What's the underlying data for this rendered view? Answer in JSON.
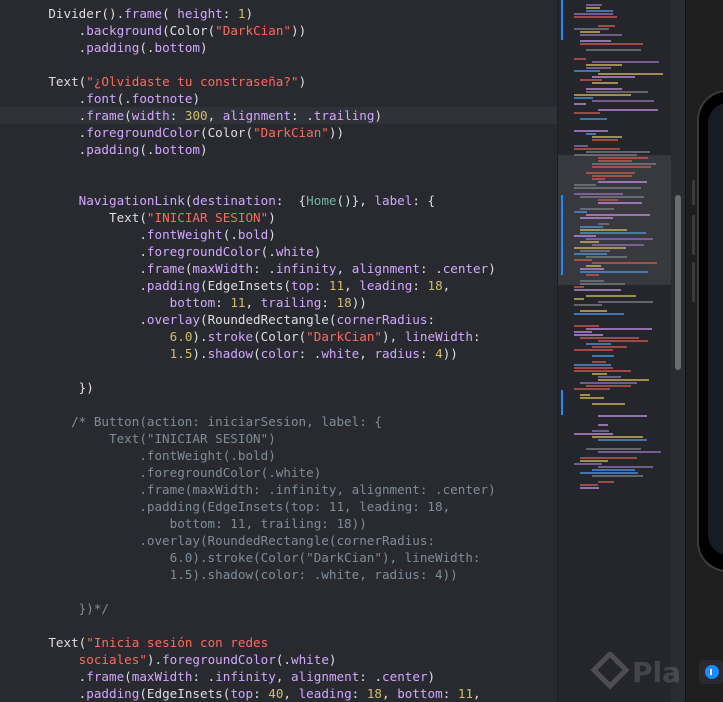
{
  "editor": {
    "lines": [
      [
        {
          "t": "    Divider().",
          "c": "t-plain"
        },
        {
          "t": "frame",
          "c": "t-kw"
        },
        {
          "t": "( ",
          "c": "t-plain"
        },
        {
          "t": "height",
          "c": "t-kw"
        },
        {
          "t": ": ",
          "c": "t-plain"
        },
        {
          "t": "1",
          "c": "t-num"
        },
        {
          "t": ")",
          "c": "t-plain"
        }
      ],
      [
        {
          "t": "        .",
          "c": "t-plain"
        },
        {
          "t": "background",
          "c": "t-kw"
        },
        {
          "t": "(Color(",
          "c": "t-plain"
        },
        {
          "t": "\"DarkCian\"",
          "c": "t-str"
        },
        {
          "t": "))",
          "c": "t-plain"
        }
      ],
      [
        {
          "t": "        .",
          "c": "t-plain"
        },
        {
          "t": "padding",
          "c": "t-kw"
        },
        {
          "t": "(.",
          "c": "t-plain"
        },
        {
          "t": "bottom",
          "c": "t-kw"
        },
        {
          "t": ")",
          "c": "t-plain"
        }
      ],
      [],
      [
        {
          "t": "    Text(",
          "c": "t-plain"
        },
        {
          "t": "\"¿Olvidaste tu constraseña?\"",
          "c": "t-str"
        },
        {
          "t": ")",
          "c": "t-plain"
        }
      ],
      [
        {
          "t": "        .",
          "c": "t-plain"
        },
        {
          "t": "font",
          "c": "t-kw"
        },
        {
          "t": "(.",
          "c": "t-plain"
        },
        {
          "t": "footnote",
          "c": "t-kw"
        },
        {
          "t": ")",
          "c": "t-plain"
        }
      ],
      [
        {
          "t": "        .",
          "c": "t-plain"
        },
        {
          "t": "frame",
          "c": "t-kw"
        },
        {
          "t": "(",
          "c": "t-plain"
        },
        {
          "t": "width",
          "c": "t-kw"
        },
        {
          "t": ": ",
          "c": "t-plain"
        },
        {
          "t": "300",
          "c": "t-num"
        },
        {
          "t": ", ",
          "c": "t-plain"
        },
        {
          "t": "alignment",
          "c": "t-kw"
        },
        {
          "t": ": .",
          "c": "t-plain"
        },
        {
          "t": "trailing",
          "c": "t-kw"
        },
        {
          "t": ")",
          "c": "t-plain"
        }
      ],
      [
        {
          "t": "        .",
          "c": "t-plain"
        },
        {
          "t": "foregroundColor",
          "c": "t-kw"
        },
        {
          "t": "(Color(",
          "c": "t-plain"
        },
        {
          "t": "\"DarkCian\"",
          "c": "t-str"
        },
        {
          "t": "))",
          "c": "t-plain"
        }
      ],
      [
        {
          "t": "        .",
          "c": "t-plain"
        },
        {
          "t": "padding",
          "c": "t-kw"
        },
        {
          "t": "(.",
          "c": "t-plain"
        },
        {
          "t": "bottom",
          "c": "t-kw"
        },
        {
          "t": ")",
          "c": "t-plain"
        }
      ],
      [],
      [],
      [
        {
          "t": "        NavigationLink",
          "c": "t-kw"
        },
        {
          "t": "(",
          "c": "t-plain"
        },
        {
          "t": "destination",
          "c": "t-kw"
        },
        {
          "t": ":  {",
          "c": "t-plain"
        },
        {
          "t": "Home",
          "c": "t-id"
        },
        {
          "t": "()}, ",
          "c": "t-plain"
        },
        {
          "t": "label",
          "c": "t-kw"
        },
        {
          "t": ": {",
          "c": "t-plain"
        }
      ],
      [
        {
          "t": "            Text(",
          "c": "t-plain"
        },
        {
          "t": "\"INICIAR SESION\"",
          "c": "t-str"
        },
        {
          "t": ")",
          "c": "t-plain"
        }
      ],
      [
        {
          "t": "                .",
          "c": "t-plain"
        },
        {
          "t": "fontWeight",
          "c": "t-kw"
        },
        {
          "t": "(.",
          "c": "t-plain"
        },
        {
          "t": "bold",
          "c": "t-kw"
        },
        {
          "t": ")",
          "c": "t-plain"
        }
      ],
      [
        {
          "t": "                .",
          "c": "t-plain"
        },
        {
          "t": "foregroundColor",
          "c": "t-kw"
        },
        {
          "t": "(.",
          "c": "t-plain"
        },
        {
          "t": "white",
          "c": "t-kw"
        },
        {
          "t": ")",
          "c": "t-plain"
        }
      ],
      [
        {
          "t": "                .",
          "c": "t-plain"
        },
        {
          "t": "frame",
          "c": "t-kw"
        },
        {
          "t": "(",
          "c": "t-plain"
        },
        {
          "t": "maxWidth",
          "c": "t-kw"
        },
        {
          "t": ": .",
          "c": "t-plain"
        },
        {
          "t": "infinity",
          "c": "t-kw"
        },
        {
          "t": ", ",
          "c": "t-plain"
        },
        {
          "t": "alignment",
          "c": "t-kw"
        },
        {
          "t": ": .",
          "c": "t-plain"
        },
        {
          "t": "center",
          "c": "t-kw"
        },
        {
          "t": ")",
          "c": "t-plain"
        }
      ],
      [
        {
          "t": "                .",
          "c": "t-plain"
        },
        {
          "t": "padding",
          "c": "t-kw"
        },
        {
          "t": "(EdgeInsets(",
          "c": "t-plain"
        },
        {
          "t": "top",
          "c": "t-kw"
        },
        {
          "t": ": ",
          "c": "t-plain"
        },
        {
          "t": "11",
          "c": "t-num"
        },
        {
          "t": ", ",
          "c": "t-plain"
        },
        {
          "t": "leading",
          "c": "t-kw"
        },
        {
          "t": ": ",
          "c": "t-plain"
        },
        {
          "t": "18",
          "c": "t-num"
        },
        {
          "t": ",",
          "c": "t-plain"
        }
      ],
      [
        {
          "t": "                    ",
          "c": "t-plain"
        },
        {
          "t": "bottom",
          "c": "t-kw"
        },
        {
          "t": ": ",
          "c": "t-plain"
        },
        {
          "t": "11",
          "c": "t-num"
        },
        {
          "t": ", ",
          "c": "t-plain"
        },
        {
          "t": "trailing",
          "c": "t-kw"
        },
        {
          "t": ": ",
          "c": "t-plain"
        },
        {
          "t": "18",
          "c": "t-num"
        },
        {
          "t": "))",
          "c": "t-plain"
        }
      ],
      [
        {
          "t": "                .",
          "c": "t-plain"
        },
        {
          "t": "overlay",
          "c": "t-kw"
        },
        {
          "t": "(RoundedRectangle(",
          "c": "t-plain"
        },
        {
          "t": "cornerRadius",
          "c": "t-kw"
        },
        {
          "t": ":",
          "c": "t-plain"
        }
      ],
      [
        {
          "t": "                    ",
          "c": "t-plain"
        },
        {
          "t": "6.0",
          "c": "t-num"
        },
        {
          "t": ").",
          "c": "t-plain"
        },
        {
          "t": "stroke",
          "c": "t-kw"
        },
        {
          "t": "(Color(",
          "c": "t-plain"
        },
        {
          "t": "\"DarkCian\"",
          "c": "t-str"
        },
        {
          "t": "), ",
          "c": "t-plain"
        },
        {
          "t": "lineWidth",
          "c": "t-kw"
        },
        {
          "t": ":",
          "c": "t-plain"
        }
      ],
      [
        {
          "t": "                    ",
          "c": "t-plain"
        },
        {
          "t": "1.5",
          "c": "t-num"
        },
        {
          "t": ").",
          "c": "t-plain"
        },
        {
          "t": "shadow",
          "c": "t-kw"
        },
        {
          "t": "(",
          "c": "t-plain"
        },
        {
          "t": "color",
          "c": "t-kw"
        },
        {
          "t": ": .",
          "c": "t-plain"
        },
        {
          "t": "white",
          "c": "t-kw"
        },
        {
          "t": ", ",
          "c": "t-plain"
        },
        {
          "t": "radius",
          "c": "t-kw"
        },
        {
          "t": ": ",
          "c": "t-plain"
        },
        {
          "t": "4",
          "c": "t-num"
        },
        {
          "t": "))",
          "c": "t-plain"
        }
      ],
      [],
      [
        {
          "t": "        })",
          "c": "t-plain"
        }
      ],
      [],
      [
        {
          "t": "       /* Button(action: iniciarSesion, label: {",
          "c": "t-cmt"
        }
      ],
      [
        {
          "t": "            Text(\"INICIAR SESION\")",
          "c": "t-cmt"
        }
      ],
      [
        {
          "t": "                .fontWeight(.bold)",
          "c": "t-cmt"
        }
      ],
      [
        {
          "t": "                .foregroundColor(.white)",
          "c": "t-cmt"
        }
      ],
      [
        {
          "t": "                .frame(maxWidth: .infinity, alignment: .center)",
          "c": "t-cmt"
        }
      ],
      [
        {
          "t": "                .padding(EdgeInsets(top: 11, leading: 18,",
          "c": "t-cmt"
        }
      ],
      [
        {
          "t": "                    bottom: 11, trailing: 18))",
          "c": "t-cmt"
        }
      ],
      [
        {
          "t": "                .overlay(RoundedRectangle(cornerRadius:",
          "c": "t-cmt"
        }
      ],
      [
        {
          "t": "                    6.0).stroke(Color(\"DarkCian\"), lineWidth:",
          "c": "t-cmt"
        }
      ],
      [
        {
          "t": "                    1.5).shadow(color: .white, radius: 4))",
          "c": "t-cmt"
        }
      ],
      [],
      [
        {
          "t": "        })*/",
          "c": "t-cmt"
        }
      ],
      [],
      [
        {
          "t": "    Text(",
          "c": "t-plain"
        },
        {
          "t": "\"Inicia sesión con redes",
          "c": "t-str"
        }
      ],
      [
        {
          "t": "        sociales\"",
          "c": "t-str"
        },
        {
          "t": ").",
          "c": "t-plain"
        },
        {
          "t": "foregroundColor",
          "c": "t-kw"
        },
        {
          "t": "(.",
          "c": "t-plain"
        },
        {
          "t": "white",
          "c": "t-kw"
        },
        {
          "t": ")",
          "c": "t-plain"
        }
      ],
      [
        {
          "t": "        .",
          "c": "t-plain"
        },
        {
          "t": "frame",
          "c": "t-kw"
        },
        {
          "t": "(",
          "c": "t-plain"
        },
        {
          "t": "maxWidth",
          "c": "t-kw"
        },
        {
          "t": ": .",
          "c": "t-plain"
        },
        {
          "t": "infinity",
          "c": "t-kw"
        },
        {
          "t": ", ",
          "c": "t-plain"
        },
        {
          "t": "alignment",
          "c": "t-kw"
        },
        {
          "t": ": .",
          "c": "t-plain"
        },
        {
          "t": "center",
          "c": "t-kw"
        },
        {
          "t": ")",
          "c": "t-plain"
        }
      ],
      [
        {
          "t": "        .",
          "c": "t-plain"
        },
        {
          "t": "padding",
          "c": "t-kw"
        },
        {
          "t": "(EdgeInsets(",
          "c": "t-plain"
        },
        {
          "t": "top",
          "c": "t-kw"
        },
        {
          "t": ": ",
          "c": "t-plain"
        },
        {
          "t": "40",
          "c": "t-num"
        },
        {
          "t": ", ",
          "c": "t-plain"
        },
        {
          "t": "leading",
          "c": "t-kw"
        },
        {
          "t": ": ",
          "c": "t-plain"
        },
        {
          "t": "18",
          "c": "t-num"
        },
        {
          "t": ", ",
          "c": "t-plain"
        },
        {
          "t": "bottom",
          "c": "t-kw"
        },
        {
          "t": ": ",
          "c": "t-plain"
        },
        {
          "t": "11",
          "c": "t-num"
        },
        {
          "t": ",",
          "c": "t-plain"
        }
      ]
    ],
    "highlighted_line": 6
  },
  "watermark": {
    "text": "Pla"
  },
  "colors": {
    "background": "#292a30",
    "keyword": "#d0a8ff",
    "string": "#fc6a5d",
    "number": "#d0bf69",
    "comment": "#7f8c98",
    "identifier": "#67b7a4",
    "plain": "#dfdfe0",
    "accent": "#1a8cff"
  }
}
